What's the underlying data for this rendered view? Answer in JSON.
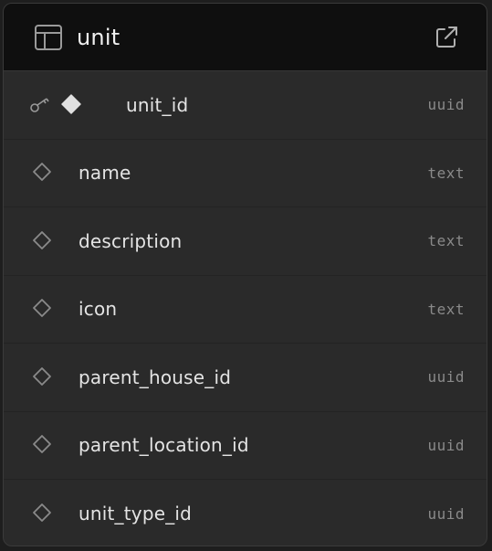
{
  "table": {
    "name": "unit",
    "icons": {
      "table": "table-icon",
      "open": "external-link-icon"
    }
  },
  "columns": [
    {
      "name": "unit_id",
      "type": "uuid",
      "primary_key": true,
      "icon": "key-icon"
    },
    {
      "name": "name",
      "type": "text",
      "primary_key": false,
      "icon": "diamond-outline-icon"
    },
    {
      "name": "description",
      "type": "text",
      "primary_key": false,
      "icon": "diamond-outline-icon"
    },
    {
      "name": "icon",
      "type": "text",
      "primary_key": false,
      "icon": "diamond-outline-icon"
    },
    {
      "name": "parent_house_id",
      "type": "uuid",
      "primary_key": false,
      "icon": "diamond-outline-icon"
    },
    {
      "name": "parent_location_id",
      "type": "uuid",
      "primary_key": false,
      "icon": "diamond-outline-icon"
    },
    {
      "name": "unit_type_id",
      "type": "uuid",
      "primary_key": false,
      "icon": "diamond-outline-icon"
    }
  ],
  "colors": {
    "header_bg": "#0f0f0f",
    "card_bg": "#2a2a2a",
    "text": "#e4e4e4",
    "type_text": "#8a8a8a"
  }
}
